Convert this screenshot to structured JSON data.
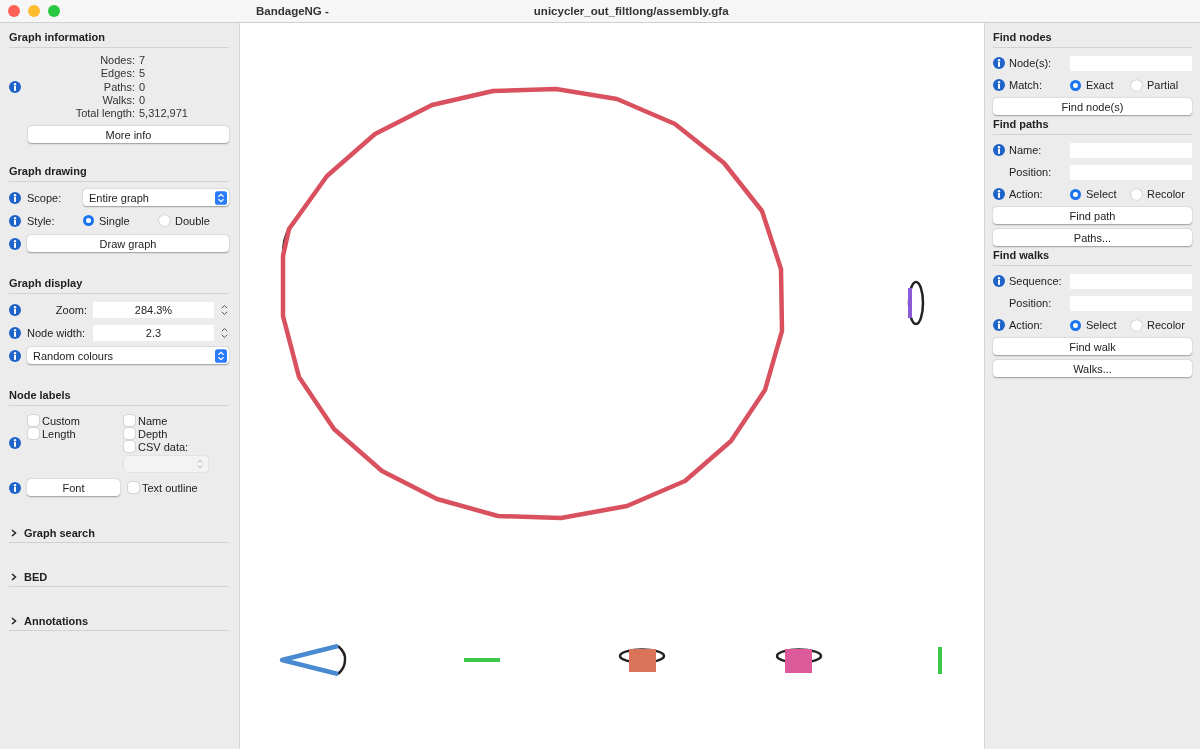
{
  "window": {
    "app_title": "BandageNG - ",
    "file_title": "unicycler_out_filtlong/assembly.gfa"
  },
  "graph_information": {
    "heading": "Graph information",
    "stats": [
      {
        "label": "Nodes:",
        "value": "7"
      },
      {
        "label": "Edges:",
        "value": "5"
      },
      {
        "label": "Paths:",
        "value": "0"
      },
      {
        "label": "Walks:",
        "value": "0"
      },
      {
        "label": "Total length:",
        "value": "5,312,971"
      }
    ],
    "button": "More info"
  },
  "graph_drawing": {
    "heading": "Graph drawing",
    "scope_label": "Scope:",
    "scope_value": "Entire graph",
    "style_label": "Style:",
    "style_options": [
      {
        "label": "Single",
        "selected": true
      },
      {
        "label": "Double",
        "selected": false
      }
    ],
    "button": "Draw graph"
  },
  "graph_display": {
    "heading": "Graph display",
    "zoom_label": "Zoom:",
    "zoom_value": "284.3%",
    "node_width_label": "Node width:",
    "node_width_value": "2.3",
    "colour_scheme": "Random colours"
  },
  "node_labels": {
    "heading": "Node labels",
    "left_options": [
      {
        "label": "Custom",
        "checked": false
      },
      {
        "label": "Length",
        "checked": false
      }
    ],
    "right_options": [
      {
        "label": "Name",
        "checked": false
      },
      {
        "label": "Depth",
        "checked": false
      },
      {
        "label": "CSV data:",
        "checked": false
      }
    ],
    "font_button": "Font",
    "text_outline": {
      "label": "Text outline",
      "checked": false
    }
  },
  "collapsed_sections": [
    {
      "label": "Graph search",
      "expanded": false
    },
    {
      "label": "BED",
      "expanded": false
    },
    {
      "label": "Annotations",
      "expanded": false
    }
  ],
  "graph": {
    "nodes": [
      {
        "color": "#d9505f"
      },
      {
        "color": "#8a5ad8"
      },
      {
        "color": "#4a8ad0"
      },
      {
        "color": "#3cc84a"
      },
      {
        "color": "#d9735a"
      },
      {
        "color": "#dd5a9a"
      },
      {
        "color": "#3cc84a"
      }
    ]
  },
  "find_nodes": {
    "heading": "Find nodes",
    "nodes_label": "Node(s):",
    "match_label": "Match:",
    "match_options": [
      {
        "label": "Exact",
        "selected": true
      },
      {
        "label": "Partial",
        "selected": false
      }
    ],
    "button": "Find node(s)"
  },
  "find_paths": {
    "heading": "Find paths",
    "name_label": "Name:",
    "position_label": "Position:",
    "action_label": "Action:",
    "action_options": [
      {
        "label": "Select",
        "selected": true
      },
      {
        "label": "Recolor",
        "selected": false
      }
    ],
    "buttons": [
      "Find path",
      "Paths..."
    ]
  },
  "find_walks": {
    "heading": "Find walks",
    "sequence_label": "Sequence:",
    "position_label": "Position:",
    "action_label": "Action:",
    "action_options": [
      {
        "label": "Select",
        "selected": true
      },
      {
        "label": "Recolor",
        "selected": false
      }
    ],
    "buttons": [
      "Find walk",
      "Walks..."
    ]
  }
}
